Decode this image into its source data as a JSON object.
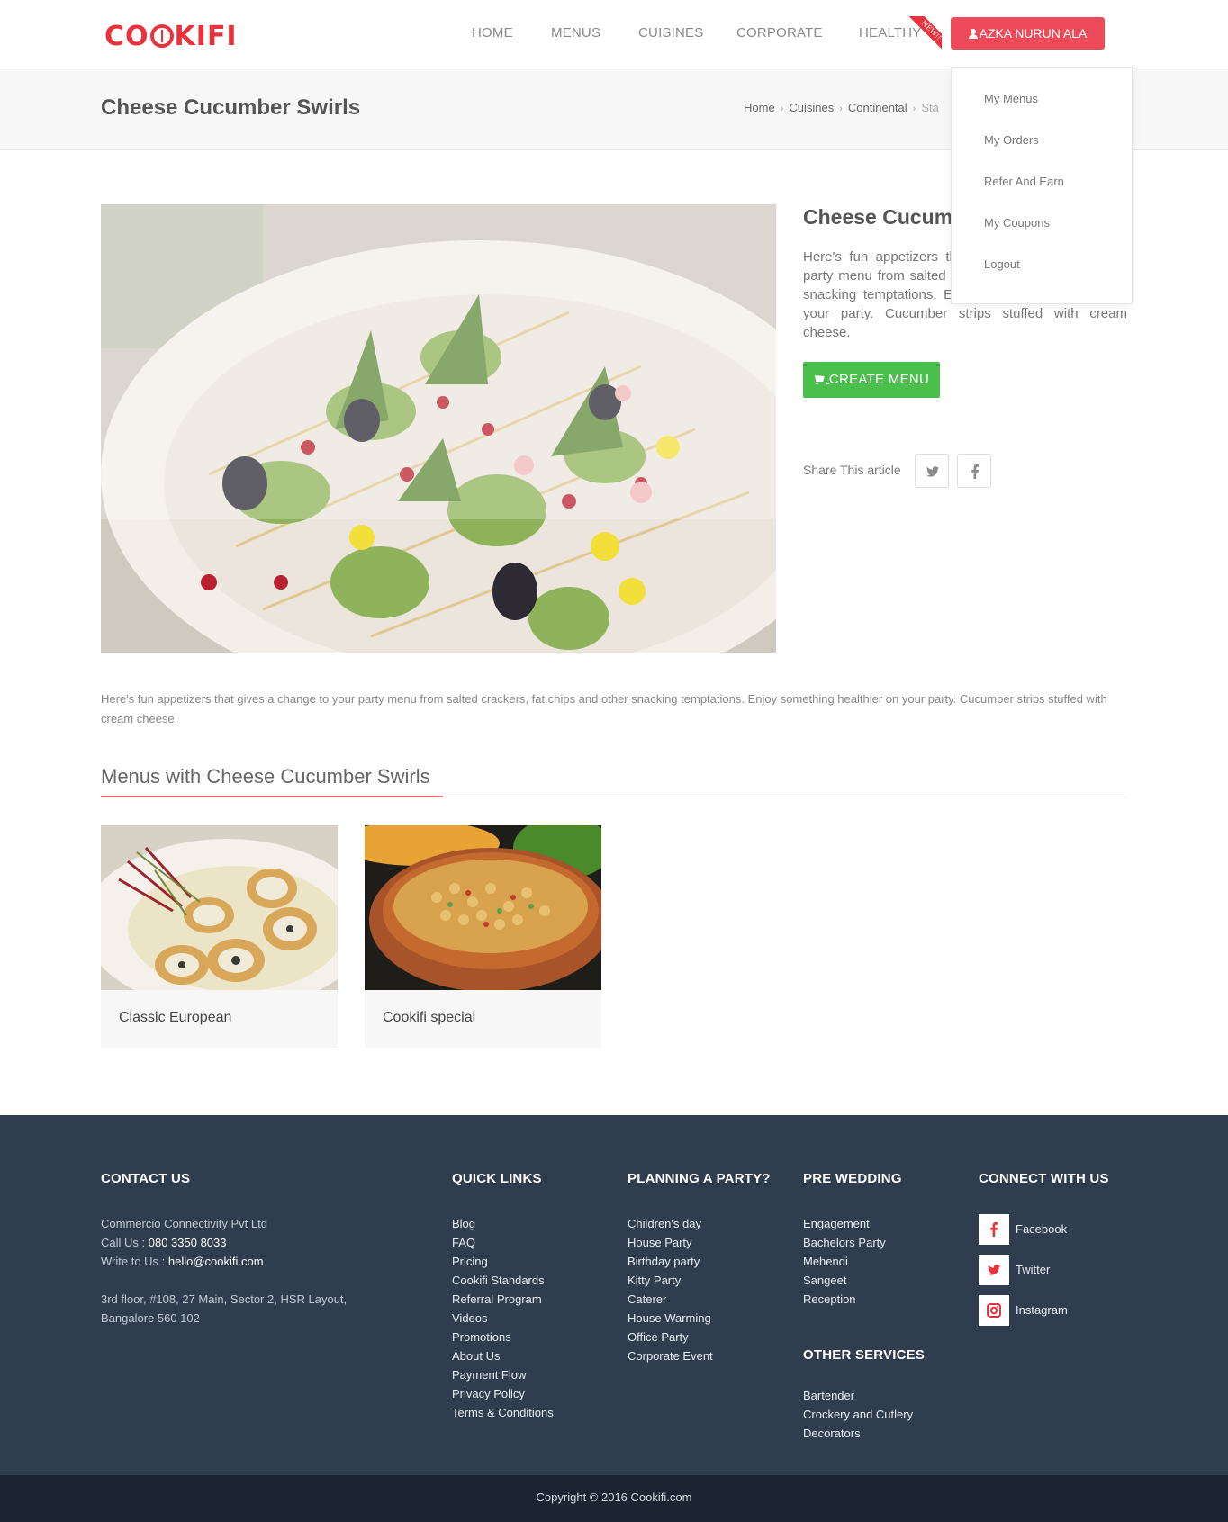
{
  "header": {
    "logo_text_1": "CO",
    "logo_text_2": "KIFI",
    "nav": [
      "HOME",
      "MENUS",
      "CUISINES",
      "CORPORATE",
      "HEALTHY"
    ],
    "new_badge": "NEW!!",
    "user_name": "AZKA NURUN ALA"
  },
  "dropdown": {
    "items": [
      "My Menus",
      "My Orders",
      "Refer And Earn",
      "My Coupons",
      "Logout"
    ]
  },
  "titlebar": {
    "title": "Cheese Cucumber Swirls",
    "breadcrumb": [
      "Home",
      "Cuisines",
      "Continental",
      "Sta"
    ]
  },
  "detail": {
    "title": "Cheese Cucumber Swirls",
    "description": "Here's fun appetizers that gives a change to your party menu from salted crackers, fat chips and other snacking temptations. Enjoy something healthier on your party. Cucumber strips stuffed with cream cheese.",
    "create_button": "CREATE MENU",
    "share_label": "Share This article"
  },
  "body_text": "Here's fun appetizers that gives a change to your party menu from salted crackers, fat chips and other snacking temptations. Enjoy something healthier on your party. Cucumber strips stuffed with cream cheese.",
  "menus_section": {
    "title": "Menus with Cheese Cucumber Swirls",
    "cards": [
      "Classic European",
      "Cookifi special"
    ]
  },
  "footer": {
    "contact": {
      "heading": "CONTACT US",
      "company": "Commercio Connectivity Pvt Ltd",
      "call_label": "Call Us : ",
      "phone": "080 3350 8033",
      "write_label": "Write to Us : ",
      "email": "hello@cookifi.com",
      "address_1": "3rd floor, #108, 27 Main, Sector 2, HSR Layout,",
      "address_2": "Bangalore 560 102"
    },
    "quick_links": {
      "heading": "QUICK LINKS",
      "items": [
        "Blog",
        "FAQ",
        "Pricing",
        "Cookifi Standards",
        "Referral Program",
        "Videos",
        "Promotions",
        "About Us",
        "Payment Flow",
        "Privacy Policy",
        "Terms & Conditions"
      ]
    },
    "planning": {
      "heading": "PLANNING A PARTY?",
      "items": [
        "Children's day",
        "House Party",
        "Birthday party",
        "Kitty Party",
        "Caterer",
        "House Warming",
        "Office Party",
        "Corporate Event"
      ]
    },
    "pre_wedding": {
      "heading": "PRE WEDDING",
      "items": [
        "Engagement",
        "Bachelors Party",
        "Mehendi",
        "Sangeet",
        "Reception"
      ]
    },
    "other_services": {
      "heading": "OTHER SERVICES",
      "items": [
        "Bartender",
        "Crockery and Cutlery",
        "Decorators"
      ]
    },
    "connect": {
      "heading": "CONNECT WITH US",
      "items": [
        "Facebook",
        "Twitter",
        "Instagram"
      ]
    },
    "copyright": "Copyright © 2016 Cookifi.com"
  },
  "colors": {
    "brand_red": "#e8323c",
    "button_red": "#ee4b5a",
    "create_green": "#4bbf4b",
    "footer_bg": "#2f3d4f",
    "copyright_bg": "#1c2431"
  }
}
